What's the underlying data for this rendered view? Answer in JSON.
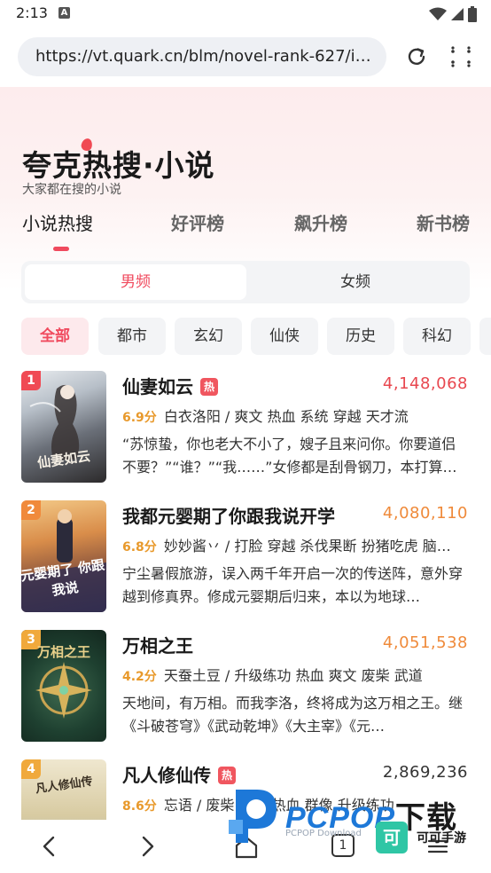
{
  "status_bar": {
    "time": "2:13",
    "notif_icon": "A"
  },
  "browser": {
    "url": "https://vt.quark.cn/blm/novel-rank-627/index.html",
    "reload_icon": "reload-icon",
    "menu_icon": "menu-icon"
  },
  "hero": {
    "title": "夸克热搜·小说",
    "subtitle": "大家都在搜的小说"
  },
  "tabs": [
    {
      "label": "小说热搜",
      "active": true
    },
    {
      "label": "好评榜"
    },
    {
      "label": "飙升榜"
    },
    {
      "label": "新书榜"
    }
  ],
  "gender": {
    "options": [
      "男频",
      "女频"
    ],
    "selected": "男频"
  },
  "categories": [
    "全部",
    "都市",
    "玄幻",
    "仙侠",
    "历史",
    "科幻"
  ],
  "selected_category": "全部",
  "books": [
    {
      "rank": "1",
      "title": "仙妻如云",
      "hot_tag": "热",
      "heat": "4,148,068",
      "score": "6.9分",
      "meta": "白衣洛阳 / 爽文 热血 系统 穿越 天才流",
      "desc": "“苏惊蛰，你也老大不小了，嫂子且来问你。你要道侣不要？”“谁？”“我……”女修都是刮骨钢刀，本打算…",
      "cover_text": "仙妻如云"
    },
    {
      "rank": "2",
      "title": "我都元婴期了你跟我说开学",
      "hot_tag": "",
      "heat": "4,080,110",
      "score": "6.8分",
      "meta": "妙妙酱丷 / 打脸 穿越 杀伐果断 扮猪吃虎 脑…",
      "desc": "宁尘暑假旅游，误入两千年开启一次的传送阵，意外穿越到修真界。修成元婴期后归来，本以为地球…",
      "cover_text": "元婴期了 你跟我说"
    },
    {
      "rank": "3",
      "title": "万相之王",
      "hot_tag": "",
      "heat": "4,051,538",
      "score": "4.2分",
      "meta": "天蚕土豆 / 升级练功 热血 爽文 废柴 武道",
      "desc": "天地间，有万相。而我李洛，终将成为这万相之王。继《斗破苍穹》《武动乾坤》《大主宰》《元…",
      "cover_text": "万相之王"
    },
    {
      "rank": "4",
      "title": "凡人修仙传",
      "hot_tag": "热",
      "heat": "2,869,236",
      "score": "8.6分",
      "meta": "忘语 / 废柴 凡人 热血 群像 升级练功",
      "desc": "",
      "cover_text": "凡人修仙传"
    }
  ],
  "colors": {
    "accent": "#f04a5e",
    "rank1": "#f04a54",
    "rank2": "#f08a3c",
    "rank3": "#f0a93c",
    "heat_top": "#e8474f",
    "heat_mid": "#ef8a3a",
    "heat_normal": "#333333",
    "score": "#e8992b"
  },
  "bottom_nav": {
    "back": "back-icon",
    "forward": "forward-icon",
    "home": "home-icon",
    "tab_count": "1",
    "more": "more-icon"
  },
  "watermark": {
    "brand": "PCPOP",
    "brand_cn": "下载",
    "sub": "PCPOP Download",
    "badge": "可",
    "sub2": "可可手游"
  }
}
